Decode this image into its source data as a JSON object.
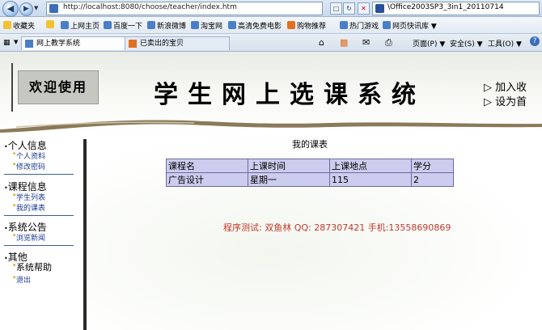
{
  "browser": {
    "url": "http://localhost:8080/choose/teacher/index.htm",
    "search_text": "\\Office2003SP3_3in1_20110714",
    "back_icon": "back-arrow-icon",
    "forward_icon": "forward-arrow-icon"
  },
  "favorites": {
    "label": "收藏夹",
    "items": [
      "上网主页",
      "百度一下",
      "新浪微博",
      "淘宝网",
      "高清免费电影",
      "购物推荐",
      "热门游戏",
      "网页快讯库"
    ]
  },
  "tabs": [
    {
      "label": "网上教学系统"
    },
    {
      "label": "已卖出的宝贝"
    }
  ],
  "commands": {
    "page": "页面(P)",
    "safety": "安全(S)",
    "tools": "工具(O)"
  },
  "header": {
    "welcome": "欢迎使用",
    "title": "学生网上选课系统",
    "add_favorite": "加入收",
    "set_home": "设为首"
  },
  "sidebar": {
    "sections": [
      {
        "title": "个人信息",
        "items": [
          "个人资料",
          "修改密码"
        ]
      },
      {
        "title": "课程信息",
        "items": [
          "学生列表",
          "我的课表"
        ]
      },
      {
        "title": "系统公告",
        "items": [
          "浏览新闻"
        ]
      },
      {
        "title": "其他",
        "items": [
          "系统帮助",
          "退出"
        ]
      }
    ]
  },
  "main": {
    "heading": "我的课表",
    "table": {
      "headers": [
        "课程名",
        "上课时间",
        "上课地点",
        "学分"
      ],
      "rows": [
        [
          "广告设计",
          "星期一",
          "115",
          "2"
        ]
      ]
    },
    "note": "程序测试: 双鱼林 QQ: 287307421 手机:13558690869"
  },
  "colors": {
    "note": "#c0392b",
    "table_bg": "#ccccee",
    "table_border": "#6a6aa0"
  }
}
